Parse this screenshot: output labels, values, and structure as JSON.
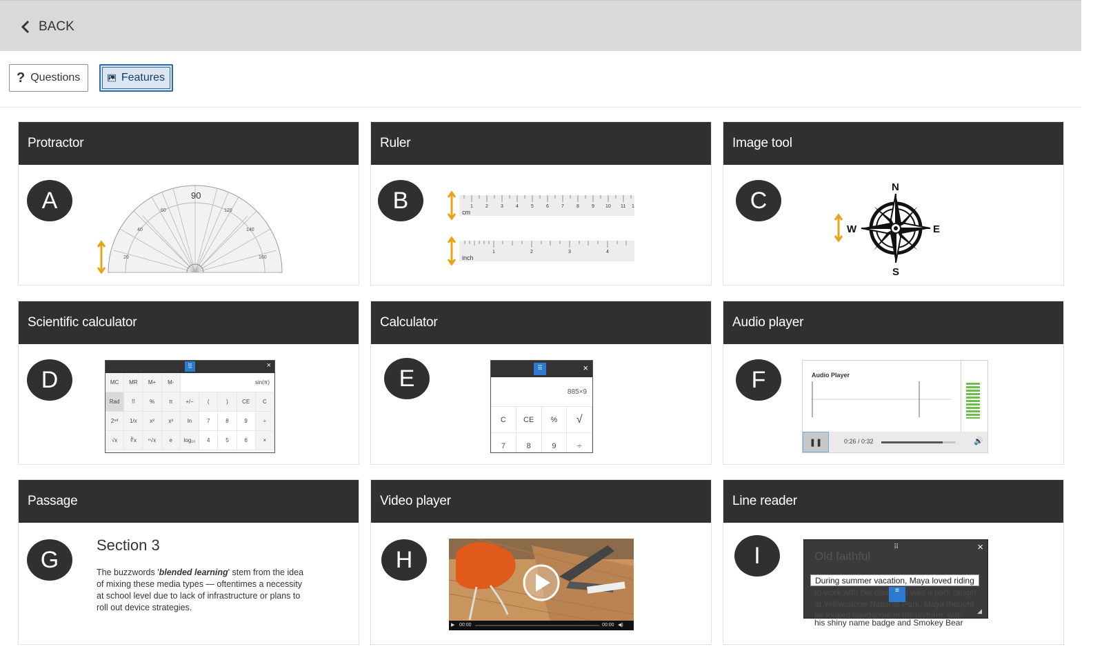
{
  "topbar": {
    "back_label": "BACK"
  },
  "tabs": {
    "questions_label": "Questions",
    "features_label": "Features",
    "questions_glyph": "?"
  },
  "cards": [
    {
      "title": "Protractor",
      "letter": "A",
      "icon": "protractor-illustration"
    },
    {
      "title": "Ruler",
      "letter": "B",
      "icon": "ruler-illustration"
    },
    {
      "title": "Image tool",
      "letter": "C",
      "icon": "compass-rose-illustration"
    },
    {
      "title": "Scientific calculator",
      "letter": "D",
      "icon": "scientific-calculator-illustration"
    },
    {
      "title": "Calculator",
      "letter": "E",
      "icon": "calculator-illustration"
    },
    {
      "title": "Audio player",
      "letter": "F",
      "icon": "audio-player-illustration"
    },
    {
      "title": "Passage",
      "letter": "G",
      "icon": "passage-illustration"
    },
    {
      "title": "Video player",
      "letter": "H",
      "icon": "video-player-illustration"
    },
    {
      "title": "Line reader",
      "letter": "I",
      "icon": "line-reader-illustration"
    }
  ],
  "protractor": {
    "top_label": "90",
    "left_labels": [
      "10",
      "20",
      "30",
      "40",
      "50",
      "60",
      "70"
    ],
    "right_labels": [
      "110",
      "120",
      "130",
      "140",
      "150",
      "160",
      "170"
    ]
  },
  "ruler": {
    "cm_label": "cm",
    "inch_label": "inch",
    "cm_ticks": [
      "1",
      "2",
      "3",
      "4",
      "5",
      "6",
      "7",
      "8",
      "9",
      "10",
      "11",
      "1"
    ],
    "inch_ticks": [
      "1",
      "2",
      "3",
      "4"
    ]
  },
  "compass": {
    "n": "N",
    "e": "E",
    "s": "S",
    "w": "W"
  },
  "sci_calc": {
    "grip": "⠿",
    "close": "×",
    "display": "sin(π)",
    "rows": [
      [
        "MC",
        "MR",
        "M+",
        "M-"
      ],
      [
        "Rad",
        "⠿",
        "%",
        "π",
        "+/−",
        "(",
        ")",
        "CE",
        "C"
      ],
      [
        "2ⁿᵈ",
        "1/x",
        "x²",
        "x³",
        "ln",
        "7",
        "8",
        "9",
        "÷"
      ],
      [
        "√x",
        "∛x",
        "ⁿ√x",
        "e",
        "log₁₀",
        "4",
        "5",
        "6",
        "×"
      ]
    ]
  },
  "calc": {
    "grip": "⠿",
    "close": "×",
    "display": "885×9",
    "keys": [
      "C",
      "CE",
      "%",
      "√",
      "7",
      "8",
      "9",
      "÷"
    ]
  },
  "audio": {
    "title": "Audio Player",
    "time": "0:26 / 0:32",
    "progress": 0.82,
    "pause_glyph": "❚❚",
    "volume_glyph": "🔊"
  },
  "passage": {
    "heading": "Section 3",
    "text_before": "The buzzwords '",
    "text_emphasis": "blended learning",
    "text_after": "' stem from the idea of mixing these media types — oftentimes a necessity at school level due to lack of infrastructure or plans to roll out device strategies."
  },
  "video": {
    "time_left": "00:00",
    "time_right": "00:00"
  },
  "line_reader": {
    "title": "Old faithful",
    "grip": "⠿",
    "close": "×",
    "focus_line": "During summer vacation, Maya loved riding",
    "dim_text": "to work with her dad, who was a park ranger at Yellowstone National Park. Maya thought he looked handsome in his uniform, with",
    "after_line": "his shiny name badge and Smokey Bear",
    "handle_glyph": "≡",
    "resize_glyph": "◢"
  },
  "colors": {
    "header_dark": "#303030",
    "accent_blue": "#2d7bd1",
    "orange_arrow": "#e8a317",
    "topbar_gray": "#d9d9d9"
  }
}
